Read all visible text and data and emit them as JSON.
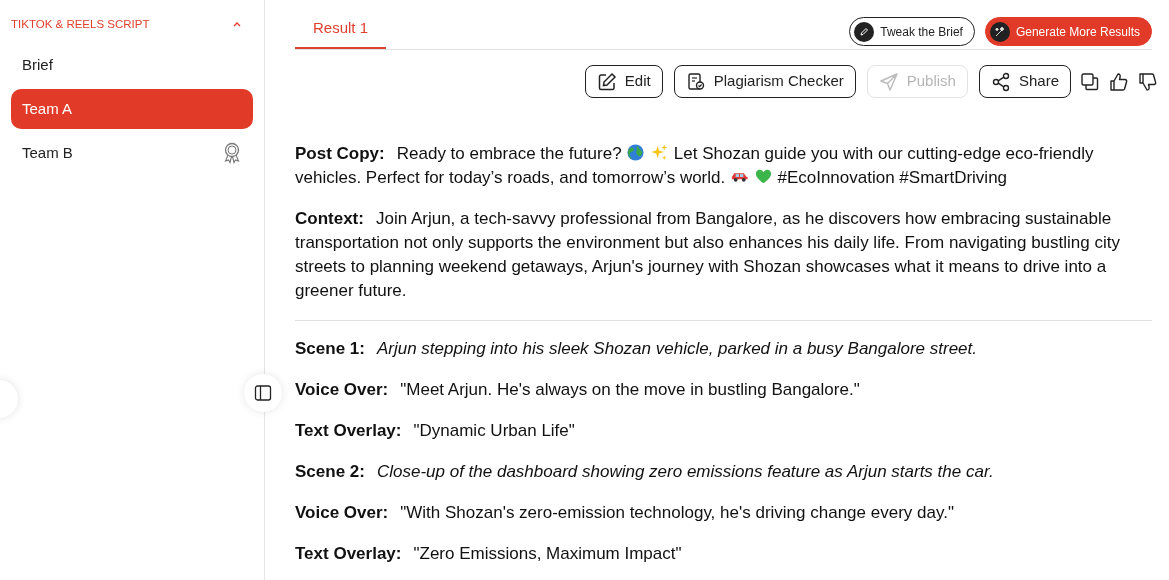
{
  "sidebar": {
    "section_title": "TIKTOK & REELS SCRIPT",
    "expanded": true,
    "items": [
      {
        "label": "Brief",
        "selected": false,
        "award": false
      },
      {
        "label": "Team A",
        "selected": true,
        "award": false
      },
      {
        "label": "Team B",
        "selected": false,
        "award": true
      }
    ]
  },
  "tabs": [
    {
      "label": "Result 1",
      "selected": true
    }
  ],
  "header_buttons": [
    {
      "kind": "tweak",
      "label": "Tweak the Brief"
    },
    {
      "kind": "generate",
      "label": "Generate More Results"
    }
  ],
  "toolbar": [
    {
      "kind": "edit",
      "label": "Edit",
      "disabled": false
    },
    {
      "kind": "plagiarism",
      "label": "Plagiarism Checker",
      "disabled": false
    },
    {
      "kind": "publish",
      "label": "Publish",
      "disabled": true
    },
    {
      "kind": "share",
      "label": "Share",
      "disabled": false
    }
  ],
  "post_copy": {
    "label": "Post Copy:",
    "parts": [
      {
        "kind": "text",
        "text": "Ready to embrace the future?"
      },
      {
        "kind": "globe"
      },
      {
        "kind": "sparkles"
      },
      {
        "kind": "text",
        "text": "Let Shozan guide you with our cutting-edge eco-friendly vehicles. Perfect for today’s roads, and tomorrow’s world."
      },
      {
        "kind": "car"
      },
      {
        "kind": "heart"
      },
      {
        "kind": "text",
        "text": "#EcoInnovation #SmartDriving"
      }
    ]
  },
  "context": {
    "label": "Context:",
    "text": "Join Arjun, a tech-savvy professional from Bangalore, as he discovers how embracing sustainable transportation not only supports the environment but also enhances his daily life. From navigating bustling city streets to planning weekend getaways, Arjun's journey with Shozan showcases what it means to drive into a greener future."
  },
  "script_lines": [
    {
      "kind": "scene",
      "label": "Scene 1:",
      "text": "Arjun stepping into his sleek Shozan vehicle, parked in a busy Bangalore street."
    },
    {
      "kind": "voice_over",
      "label": "Voice Over:",
      "text": "\"Meet Arjun. He's always on the move in bustling Bangalore.\""
    },
    {
      "kind": "text_overlay",
      "label": "Text Overlay:",
      "text": "\"Dynamic Urban Life\""
    },
    {
      "kind": "scene",
      "label": "Scene 2:",
      "text": "Close-up of the dashboard showing zero emissions feature as Arjun starts the car."
    },
    {
      "kind": "voice_over",
      "label": "Voice Over:",
      "text": "\"With Shozan's zero-emission technology, he's driving change every day.\""
    },
    {
      "kind": "text_overlay",
      "label": "Text Overlay:",
      "text": "\"Zero Emissions, Maximum Impact\""
    }
  ]
}
